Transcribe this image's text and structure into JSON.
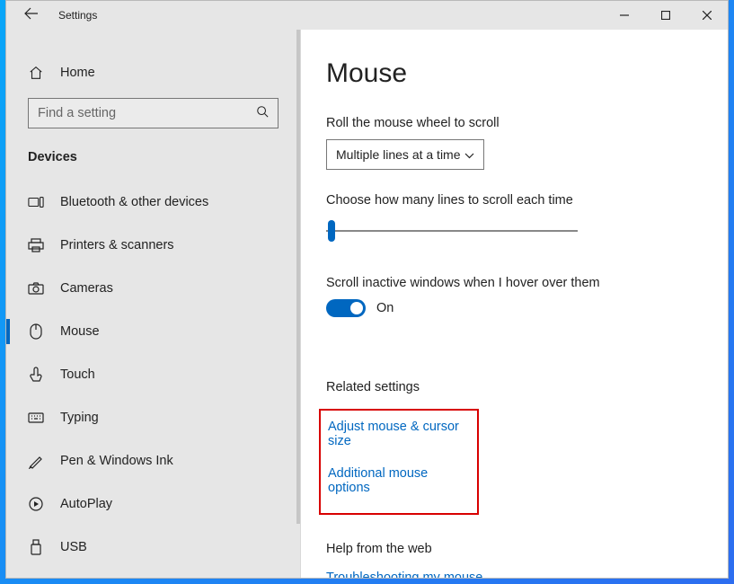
{
  "titlebar": {
    "title": "Settings"
  },
  "sidebar": {
    "home": "Home",
    "search_placeholder": "Find a setting",
    "category": "Devices",
    "items": [
      {
        "label": "Bluetooth & other devices"
      },
      {
        "label": "Printers & scanners"
      },
      {
        "label": "Cameras"
      },
      {
        "label": "Mouse"
      },
      {
        "label": "Touch"
      },
      {
        "label": "Typing"
      },
      {
        "label": "Pen & Windows Ink"
      },
      {
        "label": "AutoPlay"
      },
      {
        "label": "USB"
      }
    ]
  },
  "content": {
    "title": "Mouse",
    "scroll_label": "Roll the mouse wheel to scroll",
    "scroll_value": "Multiple lines at a time",
    "lines_label": "Choose how many lines to scroll each time",
    "inactive_label": "Scroll inactive windows when I hover over them",
    "inactive_state": "On",
    "related_title": "Related settings",
    "link_adjust": "Adjust mouse & cursor size",
    "link_additional": "Additional mouse options",
    "help_title": "Help from the web",
    "link_troubleshoot": "Troubleshooting my mouse"
  }
}
